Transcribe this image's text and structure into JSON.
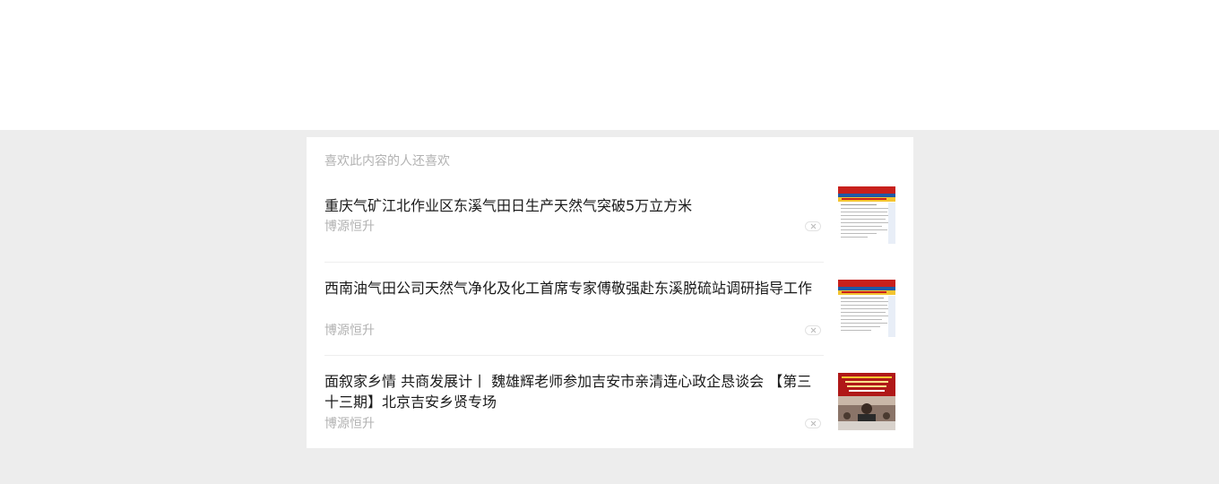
{
  "recommend": {
    "title": "喜欢此内容的人还喜欢",
    "items": [
      {
        "title": "重庆气矿江北作业区东溪气田日生产天然气突破5万立方米",
        "source": "博源恒升",
        "thumb_icon": "newspaper-thumbnail"
      },
      {
        "title": "西南油气田公司天然气净化及化工首席专家傅敬强赴东溪脱硫站调研指导工作",
        "source": "博源恒升",
        "thumb_icon": "newspaper-thumbnail"
      },
      {
        "title": "面叙家乡情 共商发展计丨 魏雄辉老师参加吉安市亲清连心政企恳谈会 【第三十三期】北京吉安乡贤专场",
        "source": "博源恒升",
        "thumb_icon": "meeting-photo-thumbnail"
      }
    ]
  },
  "colors": {
    "page_bg": "#ededed",
    "card_bg": "#ffffff",
    "title_text": "#1a1a1a",
    "meta_text": "#b2b2b2",
    "thumb_red": "#c8201c",
    "thumb_blue": "#1f5aa6",
    "thumb_yellow": "#f4c430"
  }
}
